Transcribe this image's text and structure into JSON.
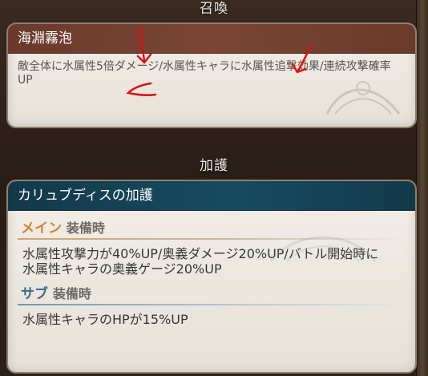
{
  "section1": {
    "title": "召喚"
  },
  "summon_card": {
    "name": "海淵霧泡",
    "description": "敵全体に水属性5倍ダメージ/水属性キャラに水属性追撃効果/連続攻撃確率UP"
  },
  "section2": {
    "title": "加護"
  },
  "aura_card": {
    "name": "カリュブディスの加護",
    "main": {
      "label_a": "メイン",
      "label_b": "装備時",
      "text": "水属性攻撃力が40%UP/奥義ダメージ20%UP/バトル開始時に水属性キャラの奥義ゲージ20%UP"
    },
    "sub": {
      "label_a": "サブ",
      "label_b": "装備時",
      "text": "水属性キャラのHPが15%UP"
    }
  },
  "colors": {
    "annotation": "#e01010",
    "summon_header": "#7a4534",
    "aura_header": "#174b60",
    "main_label": "#d77f33",
    "sub_label": "#3f6b82"
  }
}
